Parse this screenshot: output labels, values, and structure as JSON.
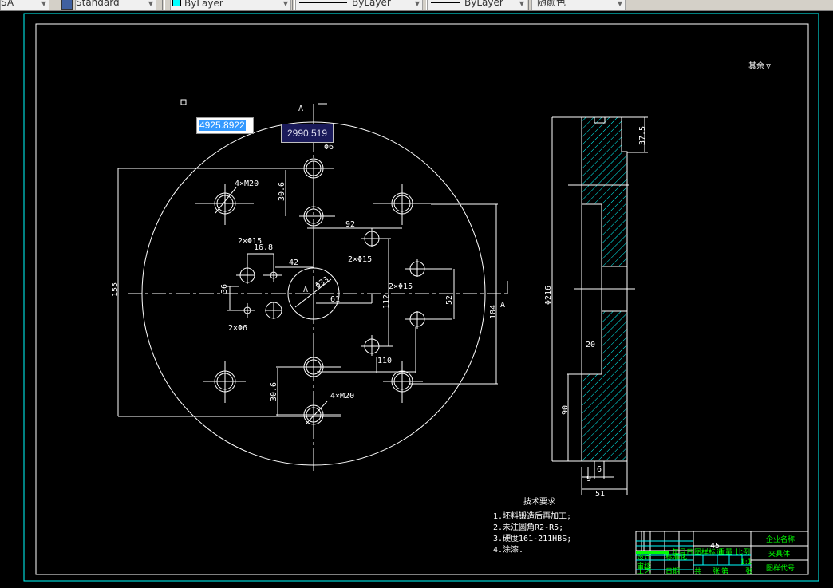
{
  "toolbar": {
    "style_combo": "SA",
    "text_style": "Standard",
    "layer_color": "ByLayer",
    "linetype": "ByLayer",
    "lineweight": "ByLayer",
    "plot_style": "随颜色",
    "layer_swatch_color": "#00ffff"
  },
  "input": {
    "coordinate_value": "4925.8922",
    "dynamic_tooltip": "2990.519"
  },
  "drawing": {
    "roughness_note": "其余",
    "section_label": "A",
    "front_view_dims": {
      "d155": "155",
      "d30_6_top": "30.6",
      "d30_6_bottom": "30.6",
      "m20_top": "4×M20",
      "m20_bottom": "4×M20",
      "d92": "92",
      "phi15_left": "2×Φ15",
      "d16_8": "16.8",
      "d42": "42",
      "d36": "36",
      "phi33": "Φ33",
      "d61": "61",
      "phi6_pair": "2×Φ6",
      "phi15_mid": "2×Φ15",
      "phi15_right": "2×Φ15",
      "d112": "112",
      "d52": "52",
      "d184": "184",
      "d110": "110",
      "phi6": "Φ6"
    },
    "side_view_dims": {
      "d37_5": "37.5",
      "phi216": "Φ216",
      "d20": "20",
      "d90": "90",
      "d6": "6",
      "d9": "9",
      "d51": "51"
    },
    "tech_req": {
      "title": "技术要求",
      "items": [
        "1.坯料锻造后再加工;",
        "2.未注圆角R2-R5;",
        "3.硬度161-211HBS;",
        "4.涂漆."
      ]
    },
    "title_block": {
      "material": "45",
      "company": "企业名称",
      "part_name": "夹具体",
      "drawing_no": "图样代号",
      "scale": "1:1",
      "labels": [
        "设计",
        "标准化",
        "审核",
        "工艺",
        "日期",
        "图样标记",
        "重量",
        "比例",
        "共",
        "张",
        "第",
        "张",
        "年月日"
      ]
    }
  },
  "colors": {
    "background": "#000000",
    "lines": "#ffffff",
    "hatch": "#00ffff",
    "title_text": "#00ff00",
    "frame_outer": "#00ffff"
  }
}
